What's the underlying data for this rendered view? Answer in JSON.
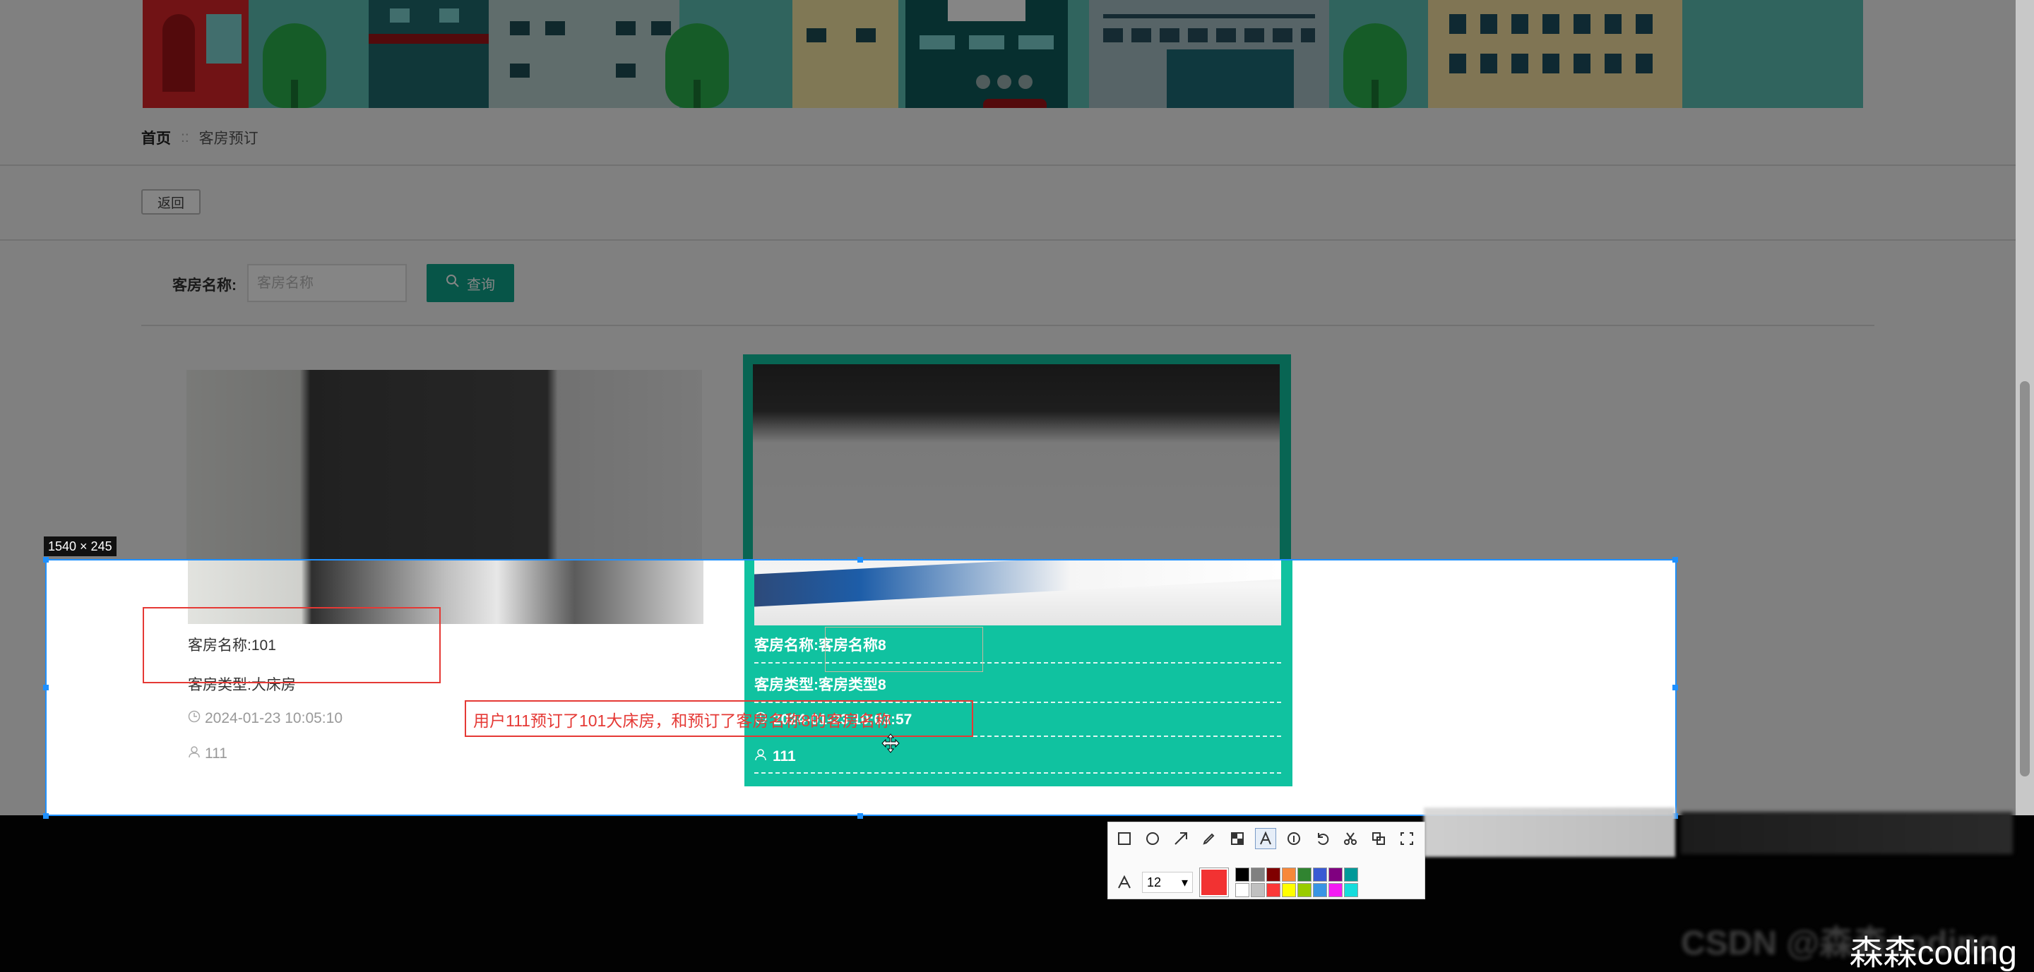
{
  "breadcrumb": {
    "home": "首页",
    "separator": "::",
    "current": "客房预订"
  },
  "toolbar_page": {
    "back_label": "返回"
  },
  "search": {
    "label": "客房名称:",
    "placeholder": "客房名称",
    "button_label": "查询"
  },
  "rooms": [
    {
      "name": "客房名称:101",
      "type": "客房类型:大床房",
      "time": "2024-01-23 10:05:10",
      "user": "111"
    },
    {
      "name": "客房名称:客房名称8",
      "type": "客房类型:客房类型8",
      "time": "2024-01-23 10:03:57",
      "user": "111"
    }
  ],
  "screenshot_tool": {
    "selection_size": "1540 × 245",
    "annotation_text": "用户111预订了101大床房，和预订了客房名称8的客房名称",
    "font_size": "12",
    "current_color": "#f23232",
    "palette": [
      "#000000",
      "#808080",
      "#800000",
      "#f7883a",
      "#308430",
      "#385ad3",
      "#800080",
      "#009999",
      "#ffffff",
      "#c0c0c0",
      "#fb3838",
      "#ffff00",
      "#99cc00",
      "#3894e4",
      "#f31bf3",
      "#16dcdc"
    ]
  },
  "watermark": "森森coding",
  "watermark_blur": "CSDN @森森coding"
}
